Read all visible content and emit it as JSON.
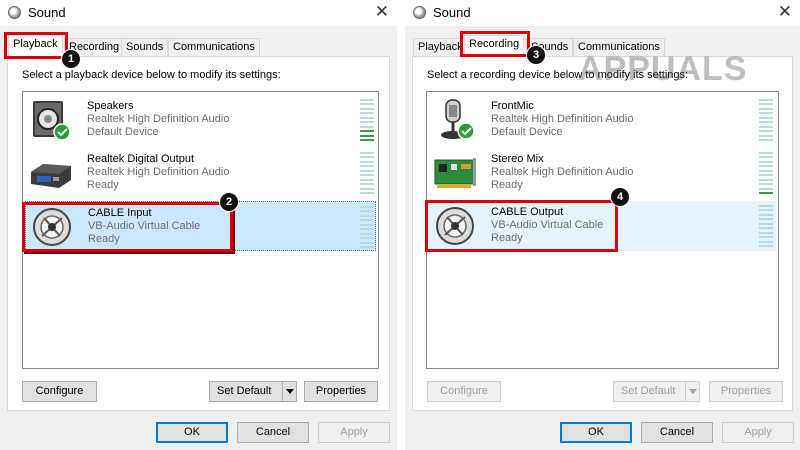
{
  "playback_dialog": {
    "title": "Sound",
    "tabs": [
      "Playback",
      "Recording",
      "Sounds",
      "Communications"
    ],
    "prompt": "Select a playback device below to modify its settings:",
    "devices": [
      {
        "name": "Speakers",
        "driver": "Realtek High Definition Audio",
        "status": "Default Device",
        "icon": "speaker-icon",
        "default": true,
        "vu_level": 0.33
      },
      {
        "name": "Realtek Digital Output",
        "driver": "Realtek High Definition Audio",
        "status": "Ready",
        "icon": "digital-output-icon",
        "default": false,
        "vu_level": 0
      },
      {
        "name": "CABLE Input",
        "driver": "VB-Audio Virtual Cable",
        "status": "Ready",
        "icon": "virtual-cable-icon",
        "default": false,
        "vu_level": 0
      }
    ],
    "buttons": {
      "configure": "Configure",
      "set_default": "Set Default",
      "properties": "Properties",
      "ok": "OK",
      "cancel": "Cancel",
      "apply": "Apply"
    }
  },
  "recording_dialog": {
    "title": "Sound",
    "tabs": [
      "Playback",
      "Recording",
      "Sounds",
      "Communications"
    ],
    "prompt": "Select a recording device below to modify its settings:",
    "devices": [
      {
        "name": "FrontMic",
        "driver": "Realtek High Definition Audio",
        "status": "Default Device",
        "icon": "microphone-icon",
        "default": true,
        "vu_level": 0
      },
      {
        "name": "Stereo Mix",
        "driver": "Realtek High Definition Audio",
        "status": "Ready",
        "icon": "sound-card-icon",
        "default": false,
        "vu_level": 0.1
      },
      {
        "name": "CABLE Output",
        "driver": "VB-Audio Virtual Cable",
        "status": "Ready",
        "icon": "virtual-cable-icon",
        "default": false,
        "vu_level": 0
      }
    ],
    "buttons": {
      "configure": "Configure",
      "set_default": "Set Default",
      "properties": "Properties",
      "ok": "OK",
      "cancel": "Cancel",
      "apply": "Apply"
    }
  },
  "annotations": {
    "steps": [
      "1",
      "2",
      "3",
      "4"
    ],
    "highlight_color": "#d9000a"
  },
  "watermark": "APPUALS",
  "colors": {
    "selection": "#cce8ff",
    "accent": "#0078d7",
    "vu_off": "#b7dbdc",
    "vu_on": "#3f9a3f"
  }
}
